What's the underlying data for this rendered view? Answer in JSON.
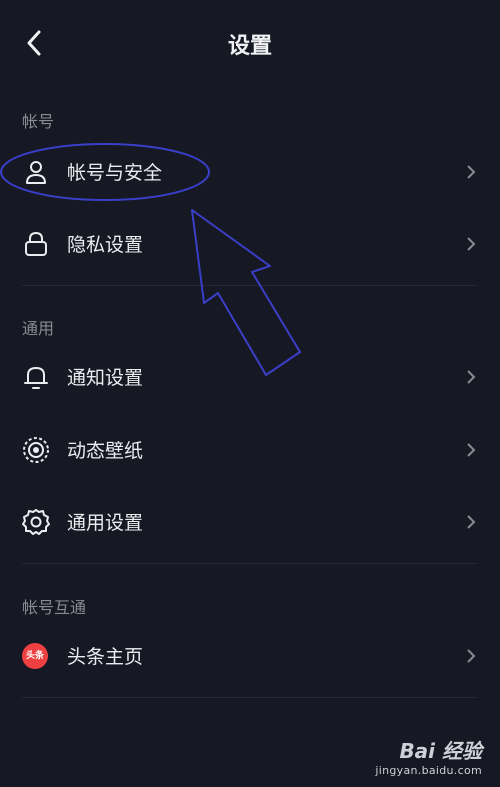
{
  "header": {
    "title": "设置",
    "back_icon": "back-arrow-icon"
  },
  "sections": [
    {
      "label": "帐号",
      "items": [
        {
          "label": "帐号与安全",
          "icon": "user-icon"
        },
        {
          "label": "隐私设置",
          "icon": "lock-icon"
        }
      ]
    },
    {
      "label": "通用",
      "items": [
        {
          "label": "通知设置",
          "icon": "bell-icon"
        },
        {
          "label": "动态壁纸",
          "icon": "live-wallpaper-icon"
        },
        {
          "label": "通用设置",
          "icon": "gear-icon"
        }
      ]
    },
    {
      "label": "帐号互通",
      "items": [
        {
          "label": "头条主页",
          "icon": "toutiao-logo-icon",
          "logo_text": "头条"
        }
      ]
    }
  ],
  "watermark": {
    "brand": "Bai 经验",
    "site": "jingyan.baidu.com"
  },
  "colors": {
    "background": "#161823",
    "annotation": "#3a3fc8",
    "toutiao": "#f04142"
  }
}
